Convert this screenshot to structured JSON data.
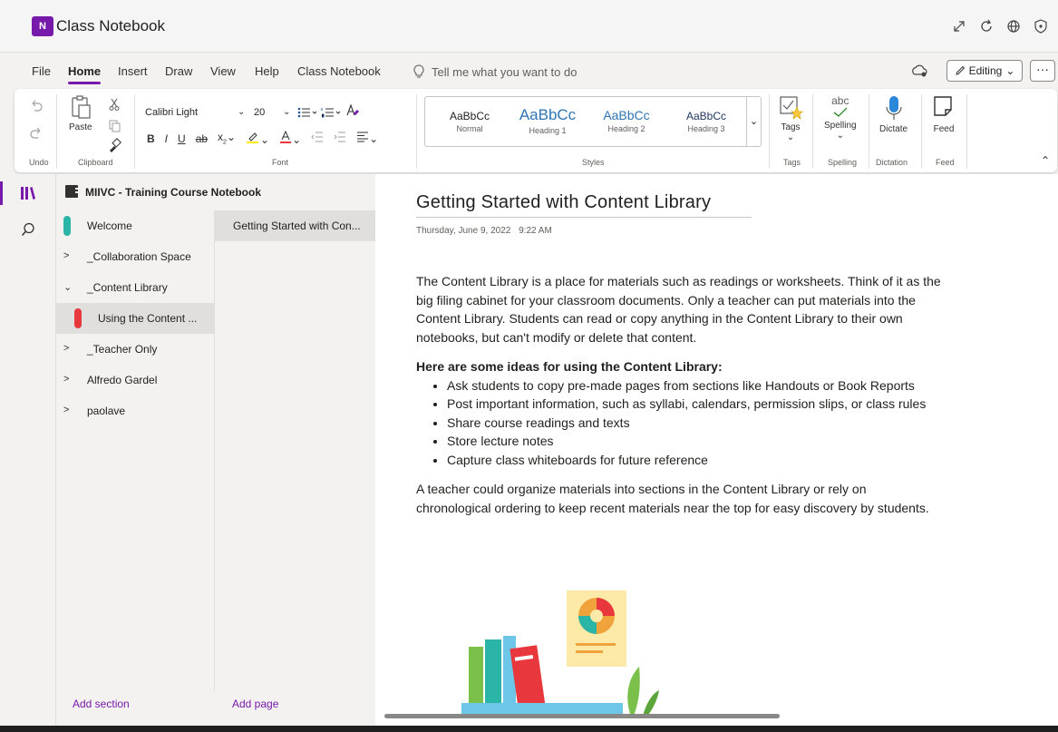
{
  "app": {
    "logo_text": "N",
    "title": "Class Notebook"
  },
  "tabs": [
    "File",
    "Home",
    "Insert",
    "Draw",
    "View",
    "Help",
    "Class Notebook"
  ],
  "active_tab": "Home",
  "tellme": {
    "placeholder": "Tell me what you want to do"
  },
  "editing_label": "Editing",
  "ribbon": {
    "undo_label": "Undo",
    "paste_label": "Paste",
    "clipboard_label": "Clipboard",
    "font_name": "Calibri Light",
    "font_size": "20",
    "font_label": "Font",
    "styles": [
      {
        "sample": "AaBbCc",
        "name": "Normal",
        "cls": ""
      },
      {
        "sample": "AaBbCc",
        "name": "Heading 1",
        "cls": "h1"
      },
      {
        "sample": "AaBbCc",
        "name": "Heading 2",
        "cls": "h2"
      },
      {
        "sample": "AaBbCc",
        "name": "Heading 3",
        "cls": "h3"
      }
    ],
    "styles_label": "Styles",
    "tags_label": "Tags",
    "tags_group": "Tags",
    "spelling_label": "Spelling",
    "spelling_group": "Spelling",
    "spelling_icon_text": "abc",
    "dictate_label": "Dictate",
    "dictation_group": "Dictation",
    "feed_label": "Feed",
    "feed_group": "Feed"
  },
  "notebook": {
    "title": "MIIVC - Training Course Notebook"
  },
  "sections": [
    {
      "label": "Welcome",
      "chevron": "",
      "color": "#2bb5a6"
    },
    {
      "label": "_Collaboration Space",
      "chevron": ">",
      "color": ""
    },
    {
      "label": "_Content Library",
      "chevron": "v",
      "color": ""
    },
    {
      "label": "Using the Content ...",
      "chevron": "",
      "color": "#e8383d"
    },
    {
      "label": "_Teacher Only",
      "chevron": ">",
      "color": ""
    },
    {
      "label": "Alfredo Gardel",
      "chevron": ">",
      "color": ""
    },
    {
      "label": "paolave",
      "chevron": ">",
      "color": ""
    }
  ],
  "pages": [
    {
      "label": "Getting Started with Con..."
    }
  ],
  "add_section": "Add section",
  "add_page": "Add page",
  "page": {
    "title": "Getting Started with Content Library",
    "date": "Thursday, June 9, 2022",
    "time": "9:22 AM",
    "intro": "The Content Library is a place for materials such as readings or worksheets.  Think of it as the big filing cabinet for your classroom documents. Only a teacher can put materials into the Content Library. Students can read or copy anything in the Content Library to their own notebooks, but can't modify or delete that content.",
    "ideas_heading": "Here are some ideas for using the Content Library:",
    "ideas": [
      "Ask students to copy pre-made pages from sections like Handouts or Book Reports",
      "Post important information, such as syllabi, calendars, permission slips, or class rules",
      "Share course readings and texts",
      "Store lecture notes",
      "Capture class whiteboards for future reference"
    ],
    "closing": "A teacher could organize materials into sections in the Content Library or rely on chronological ordering to keep recent materials near the top for easy discovery by students."
  },
  "colors": {
    "accent": "#7719aa"
  }
}
